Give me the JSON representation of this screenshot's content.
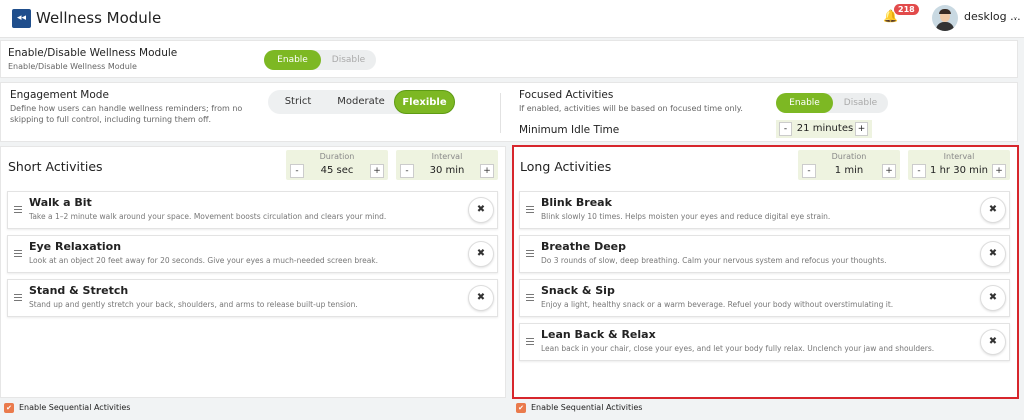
{
  "header": {
    "back_icon": "double-chevron-left-icon",
    "title": "Wellness Module",
    "bell_icon": "bell-icon",
    "notification_count": "218",
    "user_name": "desklog ...",
    "chevron_icon": "chevron-down-icon"
  },
  "module_toggle": {
    "label": "Enable/Disable Wellness Module",
    "sublabel": "Enable/Disable Wellness Module",
    "options": [
      "Enable",
      "Disable"
    ],
    "selected": "Enable"
  },
  "engagement": {
    "label": "Engagement Mode",
    "description": "Define how users can handle wellness reminders; from no skipping to full control, including turning them off.",
    "options": [
      "Strict",
      "Moderate",
      "Flexible"
    ],
    "selected": "Flexible"
  },
  "focused": {
    "label": "Focused Activities",
    "description": "If enabled, activities will be based on focused time only.",
    "options": [
      "Enable",
      "Disable"
    ],
    "selected": "Enable",
    "idle_label": "Minimum Idle Time",
    "idle_value": "21 minutes"
  },
  "short": {
    "title": "Short Activities",
    "duration_label": "Duration",
    "duration_value": "45 sec",
    "interval_label": "Interval",
    "interval_value": "30 min",
    "items": [
      {
        "name": "Walk a Bit",
        "desc": "Take a 1–2 minute walk around your space. Movement boosts circulation and clears your mind."
      },
      {
        "name": "Eye Relaxation",
        "desc": "Look at an object 20 feet away for 20 seconds. Give your eyes a much-needed screen break."
      },
      {
        "name": "Stand & Stretch",
        "desc": "Stand up and gently stretch your back, shoulders, and arms to release built-up tension."
      }
    ],
    "sequential_label": "Enable Sequential Activities"
  },
  "long": {
    "title": "Long Activities",
    "duration_label": "Duration",
    "duration_value": "1 min",
    "interval_label": "Interval",
    "interval_value": "1 hr 30 min",
    "items": [
      {
        "name": "Blink Break",
        "desc": "Blink slowly 10 times. Helps moisten your eyes and reduce digital eye strain."
      },
      {
        "name": "Breathe Deep",
        "desc": "Do 3 rounds of slow, deep breathing. Calm your nervous system and refocus your thoughts."
      },
      {
        "name": "Snack & Sip",
        "desc": "Enjoy a light, healthy snack or a warm beverage. Refuel your body without overstimulating it."
      },
      {
        "name": "Lean Back & Relax",
        "desc": "Lean back in your chair, close your eyes, and let your body fully relax. Unclench your jaw and shoulders."
      }
    ],
    "sequential_label": "Enable Sequential Activities"
  },
  "glyphs": {
    "minus": "-",
    "plus": "+",
    "close": "✖",
    "check": "✔",
    "bell": "🔔",
    "back": "◂◂",
    "chev": "⌄"
  },
  "colors": {
    "accent": "#7db823",
    "brand": "#1f4e8c",
    "badge": "#e24b4b",
    "highlight": "#d7262c",
    "checkbox": "#ea7a4c"
  }
}
